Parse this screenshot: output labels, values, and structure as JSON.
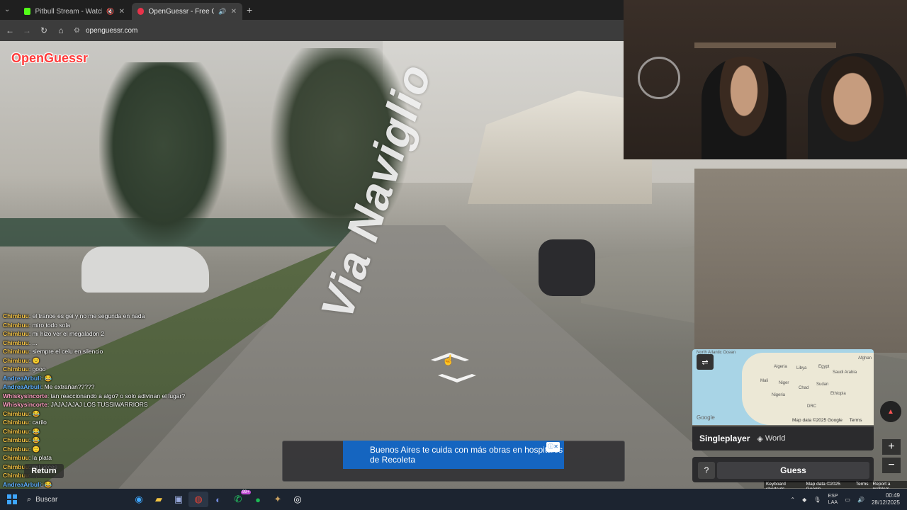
{
  "browser": {
    "tabs": [
      {
        "label": "Pitbull Stream - Watch Live",
        "active": false
      },
      {
        "label": "OpenGuessr - Free GeoGue",
        "active": true
      }
    ],
    "url": "openguessr.com"
  },
  "game": {
    "logo": "OpenGuessr",
    "street_label": "Via Naviglio",
    "return_label": "Return",
    "mode": "Singleplayer",
    "map_type": "World",
    "help_label": "?",
    "guess_label": "Guess",
    "map_attribution": "Map data ©2025 Google",
    "map_terms": "Terms",
    "map_brand": "Google",
    "map_labels": [
      "North Atlantic Ocean",
      "Algeria",
      "Libya",
      "Egypt",
      "Saudi Arabia",
      "Mali",
      "Niger",
      "Chad",
      "Sudan",
      "Nigeria",
      "Ethiopia",
      "DRC",
      "Afghan"
    ],
    "footer_links": [
      "Keyboard shortcuts",
      "Map data ©2025 Google",
      "Terms",
      "Report a problem"
    ]
  },
  "ad": {
    "text": "Buenos Aires te cuida con más obras en hospitales de Recoleta"
  },
  "chat": [
    {
      "user": "Chimbuu",
      "msg": "el tranoe es gei y no me segunda en nada",
      "c": "u1"
    },
    {
      "user": "Chimbuu",
      "msg": "miro todo sola",
      "c": "u1"
    },
    {
      "user": "Chimbuu",
      "msg": "mi hizo ver el megaladon 2",
      "c": "u1"
    },
    {
      "user": "Chimbuu",
      "msg": "...",
      "c": "u1"
    },
    {
      "user": "Chimbuu",
      "msg": "siempre el celu en silencio",
      "c": "u1"
    },
    {
      "user": "Chimbuu",
      "msg": "🙁",
      "c": "u1"
    },
    {
      "user": "Chimbuu",
      "msg": "gooo",
      "c": "u1"
    },
    {
      "user": "AndreaArbuli",
      "msg": "😂",
      "c": "u2"
    },
    {
      "user": "AndreaArbuli",
      "msg": "Me extrañan?????",
      "c": "u2"
    },
    {
      "user": "Whiskysincorte",
      "msg": "tan reaccionando a algo? o solo adivinan el lugar?",
      "c": "u3"
    },
    {
      "user": "Whiskysincorte",
      "msg": "JAJAJAJAJ LOS TUSSIWARRIORS",
      "c": "u3"
    },
    {
      "user": "Chimbuu",
      "msg": "😂",
      "c": "u1"
    },
    {
      "user": "Chimbuu",
      "msg": "carilo",
      "c": "u1"
    },
    {
      "user": "Chimbuu",
      "msg": "😂",
      "c": "u1"
    },
    {
      "user": "Chimbuu",
      "msg": "😂",
      "c": "u1"
    },
    {
      "user": "Chimbuu",
      "msg": "🙁",
      "c": "u1"
    },
    {
      "user": "Chimbuu",
      "msg": "la plata",
      "c": "u1"
    },
    {
      "user": "Chimbuu",
      "msg": "mil veces",
      "c": "u1"
    },
    {
      "user": "Chimbuu",
      "msg": "...",
      "c": "u1"
    },
    {
      "user": "AndreaArbuli",
      "msg": "😂",
      "c": "u2"
    }
  ],
  "taskbar": {
    "search_placeholder": "Buscar",
    "whatsapp_badge": "99+",
    "lang_line1": "ESP",
    "lang_line2": "LAA",
    "time": "00:49",
    "date": "28/12/2025"
  },
  "colors": {
    "logo_red": "#ff3b3b",
    "panel_dark": "#2b2b2d",
    "taskbar": "#1c2430"
  }
}
